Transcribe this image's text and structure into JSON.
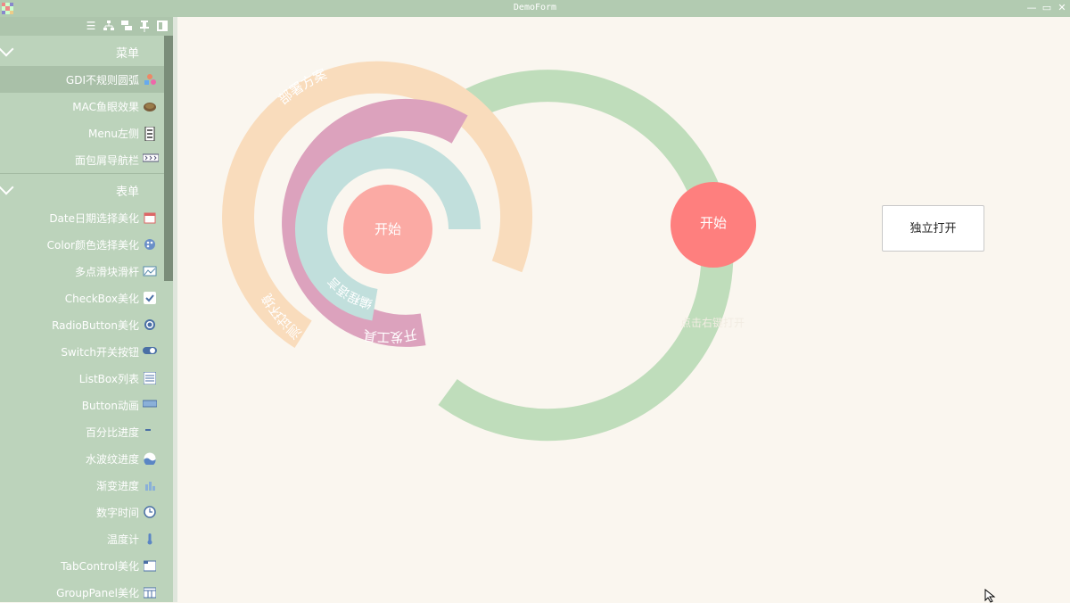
{
  "window": {
    "title": "DemoForm",
    "controls": [
      "minimize-icon",
      "maximize-icon",
      "close-icon"
    ]
  },
  "sidebar": {
    "toolbar_icons": [
      "list-icon",
      "tree-icon",
      "cascade-icon",
      "pin-icon",
      "panel-icon"
    ],
    "sections": [
      {
        "header": "菜单",
        "items": [
          {
            "label": "GDI不规则圆弧",
            "icon": "shapes-icon",
            "active": true
          },
          {
            "label": "MAC鱼眼效果",
            "icon": "turtle-icon"
          },
          {
            "label": "Menu左侧",
            "icon": "menu-left-icon"
          },
          {
            "label": "面包屑导航栏",
            "icon": "breadcrumb-icon"
          }
        ]
      },
      {
        "header": "表单",
        "items": [
          {
            "label": "Date日期选择美化",
            "icon": "calendar-icon"
          },
          {
            "label": "Color颜色选择美化",
            "icon": "palette-icon"
          },
          {
            "label": "多点滑块滑杆",
            "icon": "slider-icon"
          },
          {
            "label": "CheckBox美化",
            "icon": "checkbox-icon"
          },
          {
            "label": "RadioButton美化",
            "icon": "radio-icon"
          },
          {
            "label": "Switch开关按钮",
            "icon": "switch-icon"
          },
          {
            "label": "ListBox列表",
            "icon": "listbox-icon"
          },
          {
            "label": "Button动画",
            "icon": "button-icon"
          },
          {
            "label": "百分比进度",
            "icon": "progress-icon"
          },
          {
            "label": "水波纹进度",
            "icon": "wave-icon"
          },
          {
            "label": "渐变进度",
            "icon": "gradient-icon"
          },
          {
            "label": "数字时间",
            "icon": "clock-icon"
          },
          {
            "label": "温度计",
            "icon": "thermometer-icon"
          },
          {
            "label": "TabControl美化",
            "icon": "tabcontrol-icon"
          },
          {
            "label": "GroupPanel美化",
            "icon": "grouppanel-icon"
          }
        ]
      }
    ]
  },
  "main": {
    "ring_menu": {
      "center_label": "开始",
      "colors": {
        "center": "#fbaaa4",
        "ring1": "#c1dfdc",
        "ring2": "#dca2bd",
        "ring3": "#f9dcbc",
        "ring4": "#bfddbb"
      },
      "rings": [
        {
          "label": "编程语言"
        },
        {
          "label": "开发工具"
        },
        {
          "label": "测试环境"
        },
        {
          "label": "部署方案"
        }
      ]
    },
    "start_button": {
      "label": "开始",
      "color": "#fe7f7e"
    },
    "hint": "点击右键打开",
    "open_button": {
      "label": "独立打开"
    }
  }
}
